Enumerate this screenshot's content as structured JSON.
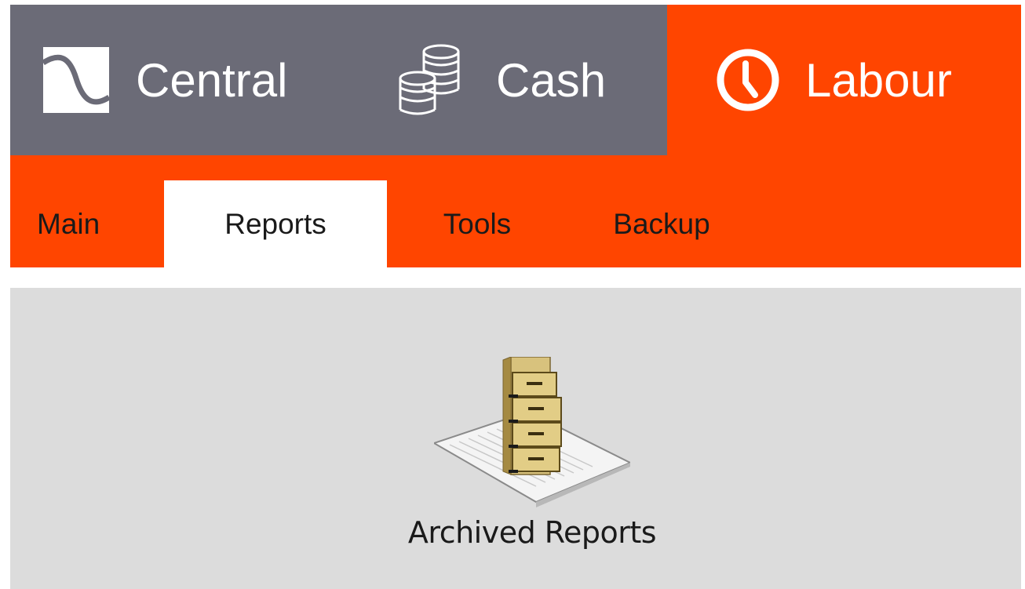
{
  "modules": {
    "central": {
      "label": "Central",
      "icon": "wave-icon"
    },
    "cash": {
      "label": "Cash",
      "icon": "coins-icon"
    },
    "labour": {
      "label": "Labour",
      "icon": "clock-icon",
      "active": true
    }
  },
  "tabs": {
    "main": {
      "label": "Main"
    },
    "reports": {
      "label": "Reports",
      "active": true
    },
    "tools": {
      "label": "Tools"
    },
    "backup": {
      "label": "Backup"
    }
  },
  "content": {
    "archived_reports": {
      "label": "Archived Reports",
      "icon": "filing-cabinet-icon"
    }
  },
  "colors": {
    "module_bar": "#6b6b77",
    "accent": "#ff4500",
    "content_bg": "#dcdcdc",
    "active_tab": "#ffffff"
  }
}
